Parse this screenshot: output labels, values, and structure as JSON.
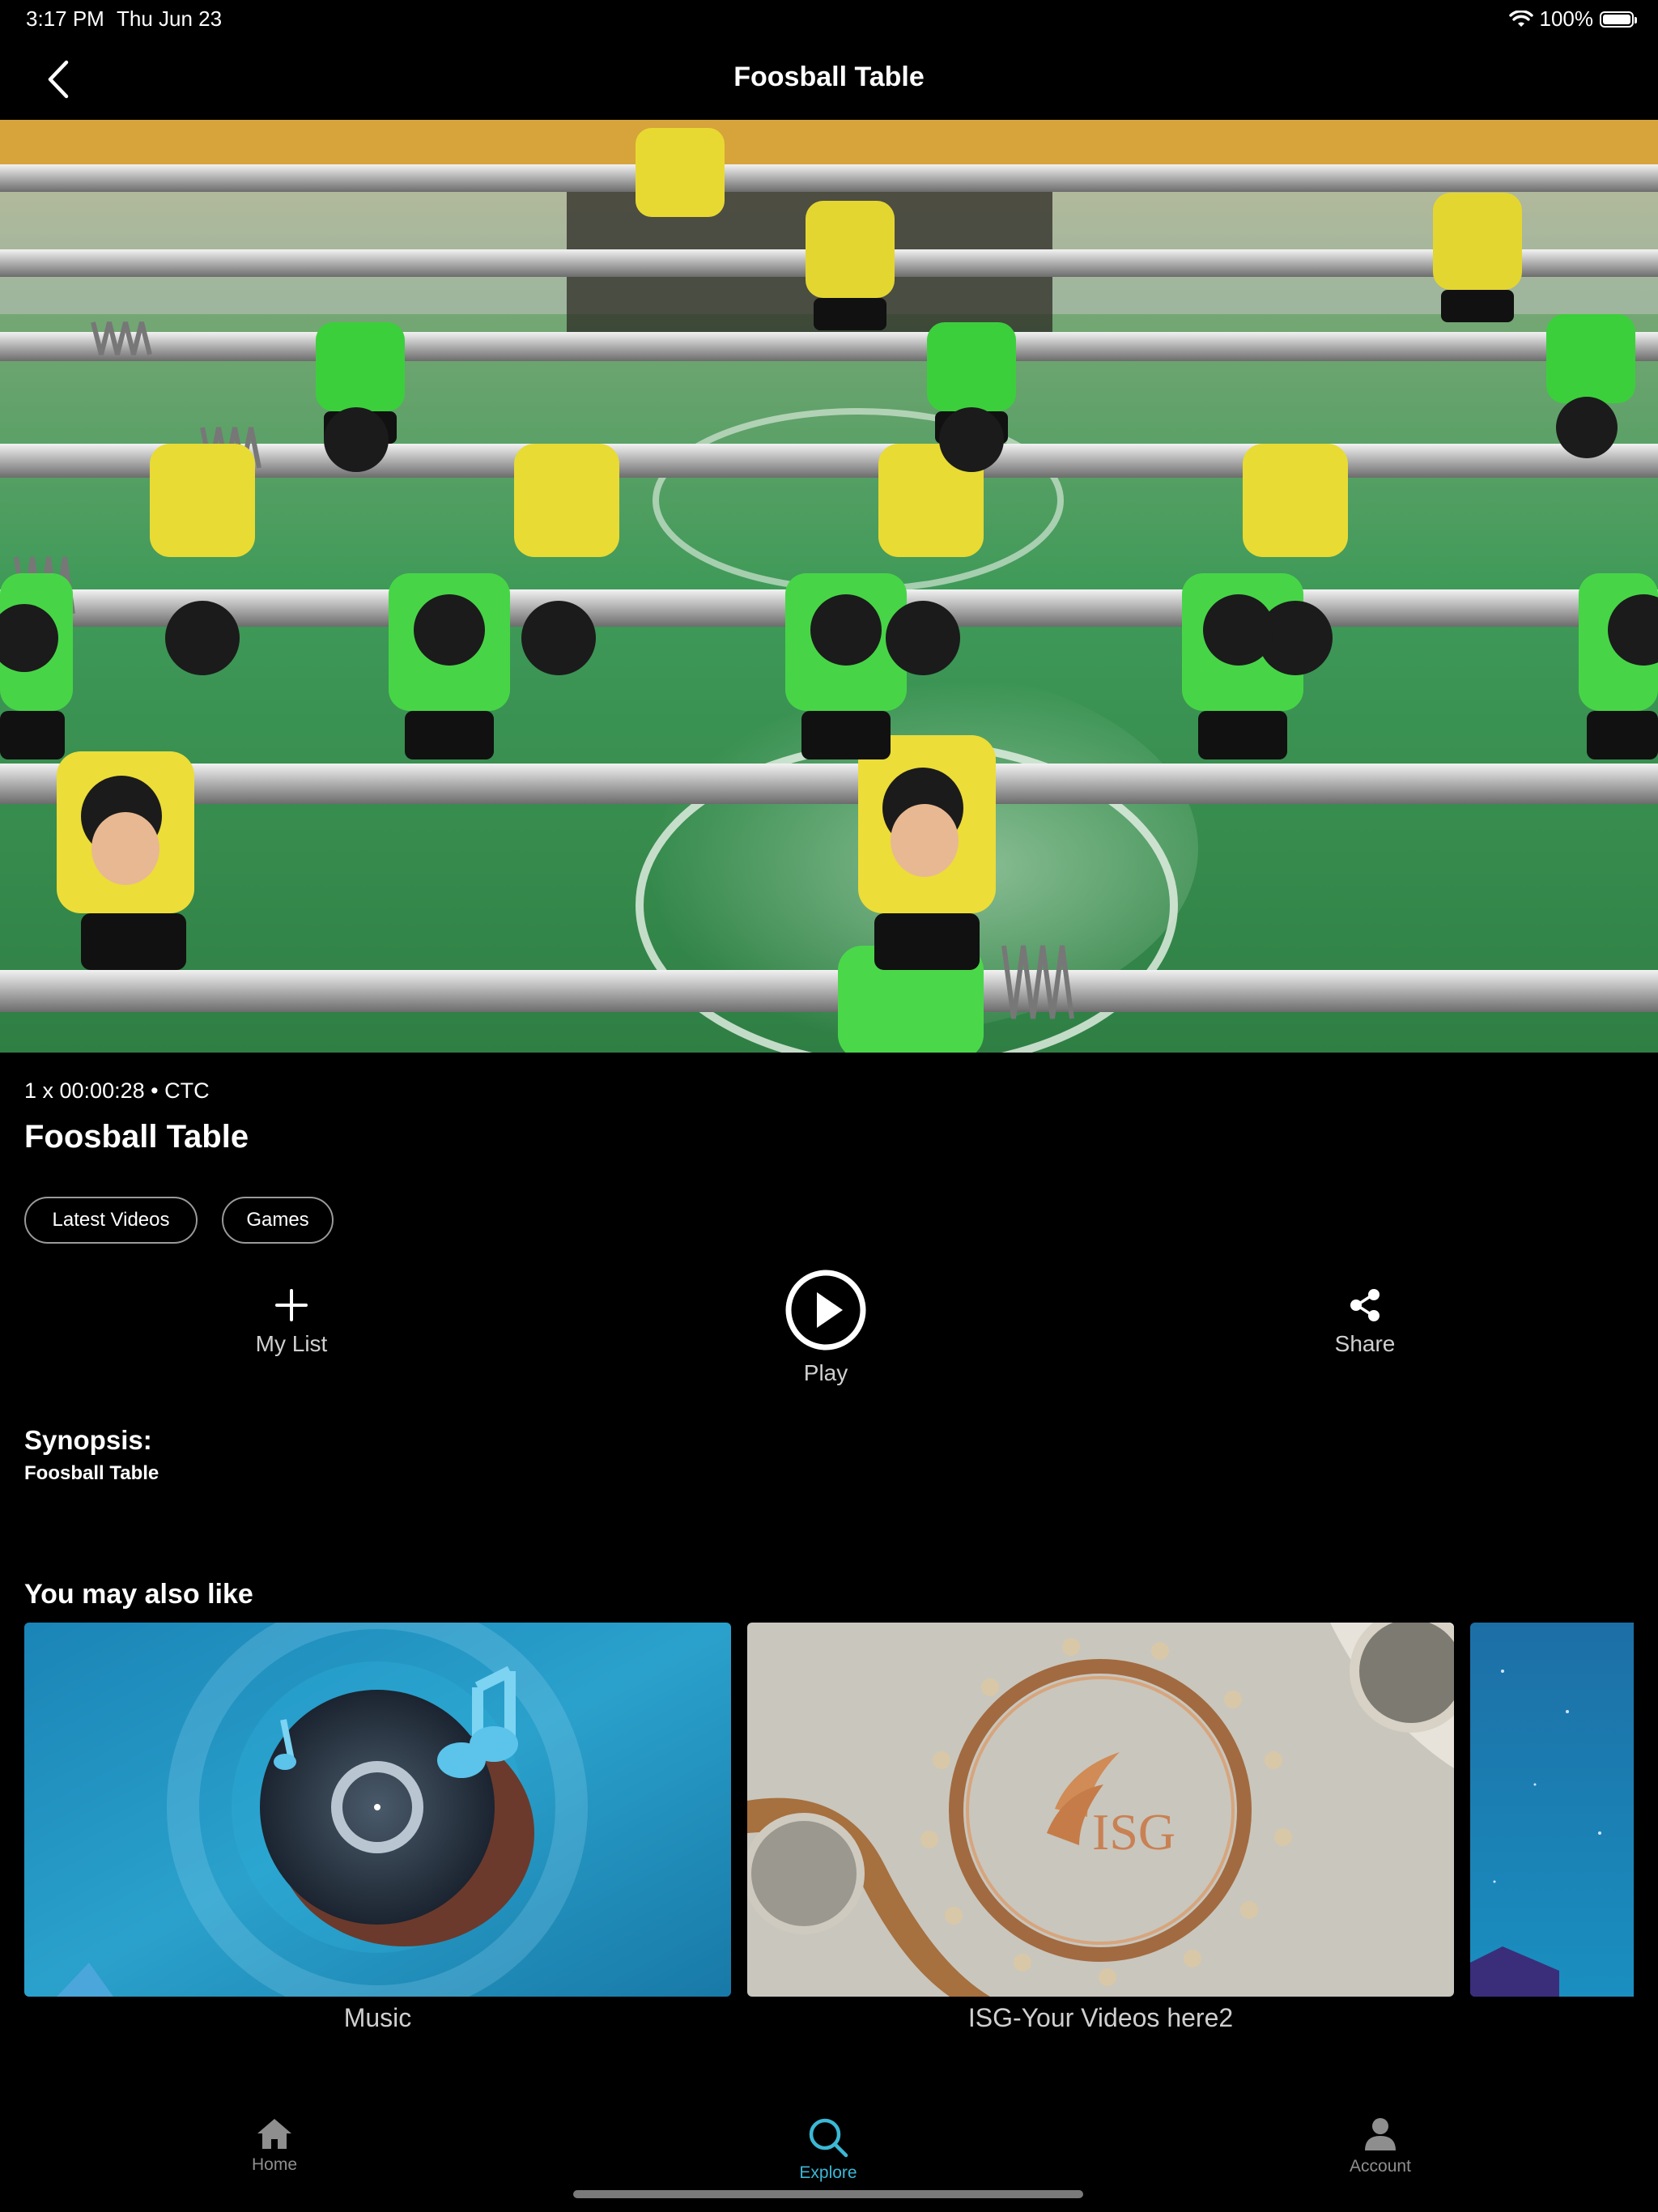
{
  "status_bar": {
    "time": "3:17 PM",
    "date": "Thu Jun 23",
    "battery": "100%"
  },
  "nav": {
    "title": "Foosball Table",
    "back_icon": "chevron-left-icon"
  },
  "video": {
    "meta": "1 x 00:00:28  • CTC",
    "title": "Foosball Table",
    "tags": [
      "Latest Videos",
      "Games"
    ]
  },
  "actions": {
    "my_list": "My List",
    "play": "Play",
    "share": "Share"
  },
  "synopsis": {
    "label": "Synopsis:",
    "text": "Foosball Table"
  },
  "recommendations": {
    "heading": "You may also like",
    "items": [
      {
        "title": "Music"
      },
      {
        "title": "ISG-Your Videos here2",
        "logo_text": "ISG"
      },
      {
        "title": ""
      }
    ]
  },
  "tab_bar": {
    "items": [
      {
        "label": "Home",
        "icon": "home-icon",
        "active": false
      },
      {
        "label": "Explore",
        "icon": "search-icon",
        "active": true
      },
      {
        "label": "Account",
        "icon": "person-icon",
        "active": false
      }
    ],
    "active_color": "#3bb8d6",
    "inactive_color": "#8e8e8e"
  }
}
